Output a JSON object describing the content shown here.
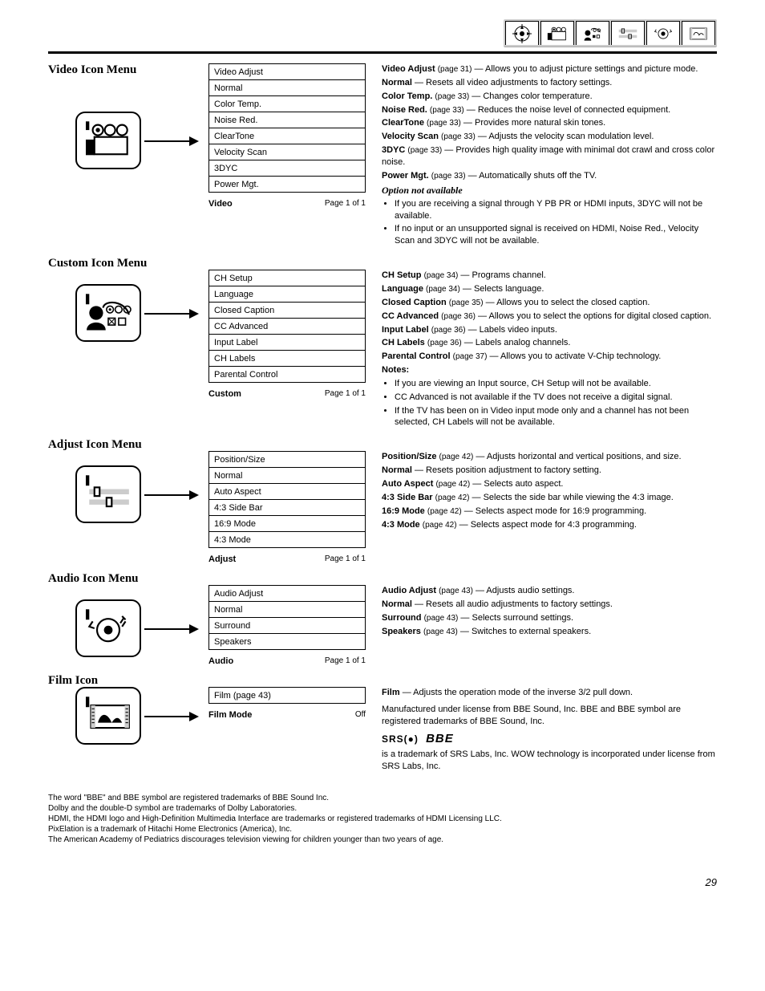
{
  "header_tabs": [
    "setup",
    "video",
    "custom",
    "adjust",
    "audio",
    "film"
  ],
  "sections": {
    "video": {
      "title": "Video Icon Menu",
      "items": [
        {
          "label": "Video Adjust",
          "pg": "(page 31)",
          "desc": "Allows you to adjust picture settings and picture mode."
        },
        {
          "label": "Normal",
          "pg": "",
          "desc": "Resets all video adjustments to factory settings."
        },
        {
          "label": "Color Temp.",
          "pg": "(page 33)",
          "desc": "Changes color temperature."
        },
        {
          "label": "Noise Red.",
          "pg": "(page 33)",
          "desc": "Reduces the noise level of connected equipment."
        },
        {
          "label": "ClearTone",
          "pg": "(page 33)",
          "desc": "Provides more natural skin tones."
        },
        {
          "label": "Velocity Scan",
          "pg": "(page 33)",
          "desc": "Adjusts the velocity scan modulation level."
        },
        {
          "label": "3DYC",
          "pg": "(page 33)",
          "desc": "Provides high quality image with minimal dot crawl and cross color noise."
        },
        {
          "label": "Power Mgt.",
          "pg": "(page 33)",
          "desc": "Automatically shuts off the TV."
        }
      ],
      "table_footer_label": "Video",
      "table_footer_text": "Page 1 of 1",
      "notes1_title": "Option not available",
      "notes1": [
        "If you are receiving a signal through Y PB PR or HDMI inputs, 3DYC will not be available.",
        "If no input or an unsupported signal is received on HDMI, Noise Red., Velocity Scan and 3DYC will not be available."
      ]
    },
    "custom": {
      "title": "Custom Icon Menu",
      "items": [
        {
          "label": "CH Setup",
          "pg": "(page 34)",
          "desc": "Programs channel."
        },
        {
          "label": "Language",
          "pg": "(page 34)",
          "desc": "Selects language."
        },
        {
          "label": "Closed Caption",
          "pg": "(page 35)",
          "desc": "Allows you to select the closed caption."
        },
        {
          "label": "CC Advanced",
          "pg": "(page 36)",
          "desc": "Allows you to select the options for digital closed caption."
        },
        {
          "label": "Input Label",
          "pg": "(page 36)",
          "desc": "Labels video inputs."
        },
        {
          "label": "CH Labels",
          "pg": "(page 36)",
          "desc": "Labels analog channels."
        },
        {
          "label": "Parental Control",
          "pg": "(page 37)",
          "desc": "Allows you to activate V-Chip technology."
        }
      ],
      "table_footer_label": "Custom",
      "table_footer_text": "Page 1 of 1",
      "notes2_title": "Notes:",
      "notes2": [
        "If you are viewing an Input source, CH Setup will not be available.",
        "CC Advanced is not available if the TV does not receive a digital signal.",
        "If the TV has been on in Video input mode only and a channel has not been selected, CH Labels will not be available."
      ]
    },
    "adjust": {
      "title": "Adjust Icon Menu",
      "items": [
        {
          "label": "Position/Size",
          "pg": "(page 42)",
          "desc": "Adjusts horizontal and vertical positions, and size."
        },
        {
          "label": "Normal",
          "pg": "",
          "desc": "Resets position adjustment to factory setting."
        },
        {
          "label": "Auto Aspect",
          "pg": "(page 42)",
          "desc": "Selects auto aspect."
        },
        {
          "label": "4:3 Side Bar",
          "pg": "(page 42)",
          "desc": "Selects the side bar while viewing the 4:3 image."
        },
        {
          "label": "16:9 Mode",
          "pg": "(page 42)",
          "desc": "Selects aspect mode for 16:9 programming."
        },
        {
          "label": "4:3 Mode",
          "pg": "(page 42)",
          "desc": "Selects aspect mode for 4:3 programming."
        }
      ],
      "table_footer_label": "Adjust",
      "table_footer_text": "Page 1 of 1"
    },
    "audio": {
      "title": "Audio Icon Menu",
      "items": [
        {
          "label": "Audio Adjust",
          "pg": "(page 43)",
          "desc": "Adjusts audio settings."
        },
        {
          "label": "Normal",
          "pg": "",
          "desc": "Resets all audio adjustments to factory settings."
        },
        {
          "label": "Surround",
          "pg": "(page 43)",
          "desc": "Selects surround settings."
        },
        {
          "label": "Speakers",
          "pg": "(page 43)",
          "desc": "Switches to external speakers."
        }
      ],
      "table_footer_label": "Audio",
      "table_footer_text": "Page 1 of 1"
    },
    "film": {
      "title": "Film Icon",
      "items": [
        {
          "label": "Film (page 43)"
        }
      ],
      "table_footer_label": "Film Mode",
      "table_footer_text": "Off",
      "desc_heading": "Film",
      "desc_body": "— Adjusts the operation mode of the inverse 3/2 pull down.",
      "srs_line_prefix": "Manufactured under license from BBE Sound, Inc. BBE and BBE symbol are registered trademarks of BBE Sound, Inc.",
      "srs_notice": "is a trademark of SRS Labs, Inc. WOW technology is incorporated under license from SRS Labs, Inc."
    }
  },
  "tm_block": {
    "p1": "The word \"BBE\" and BBE symbol are registered trademarks of BBE Sound Inc.",
    "p2": "Dolby and the double-D symbol are trademarks of Dolby Laboratories.",
    "p3": "HDMI, the HDMI logo and High-Definition Multimedia Interface are trademarks or registered trademarks of HDMI Licensing LLC.",
    "p4": "PixElation is a trademark of Hitachi Home Electronics (America), Inc.",
    "p5": "The American Academy of Pediatrics discourages television viewing for children younger than two years of age."
  },
  "pg": "29"
}
